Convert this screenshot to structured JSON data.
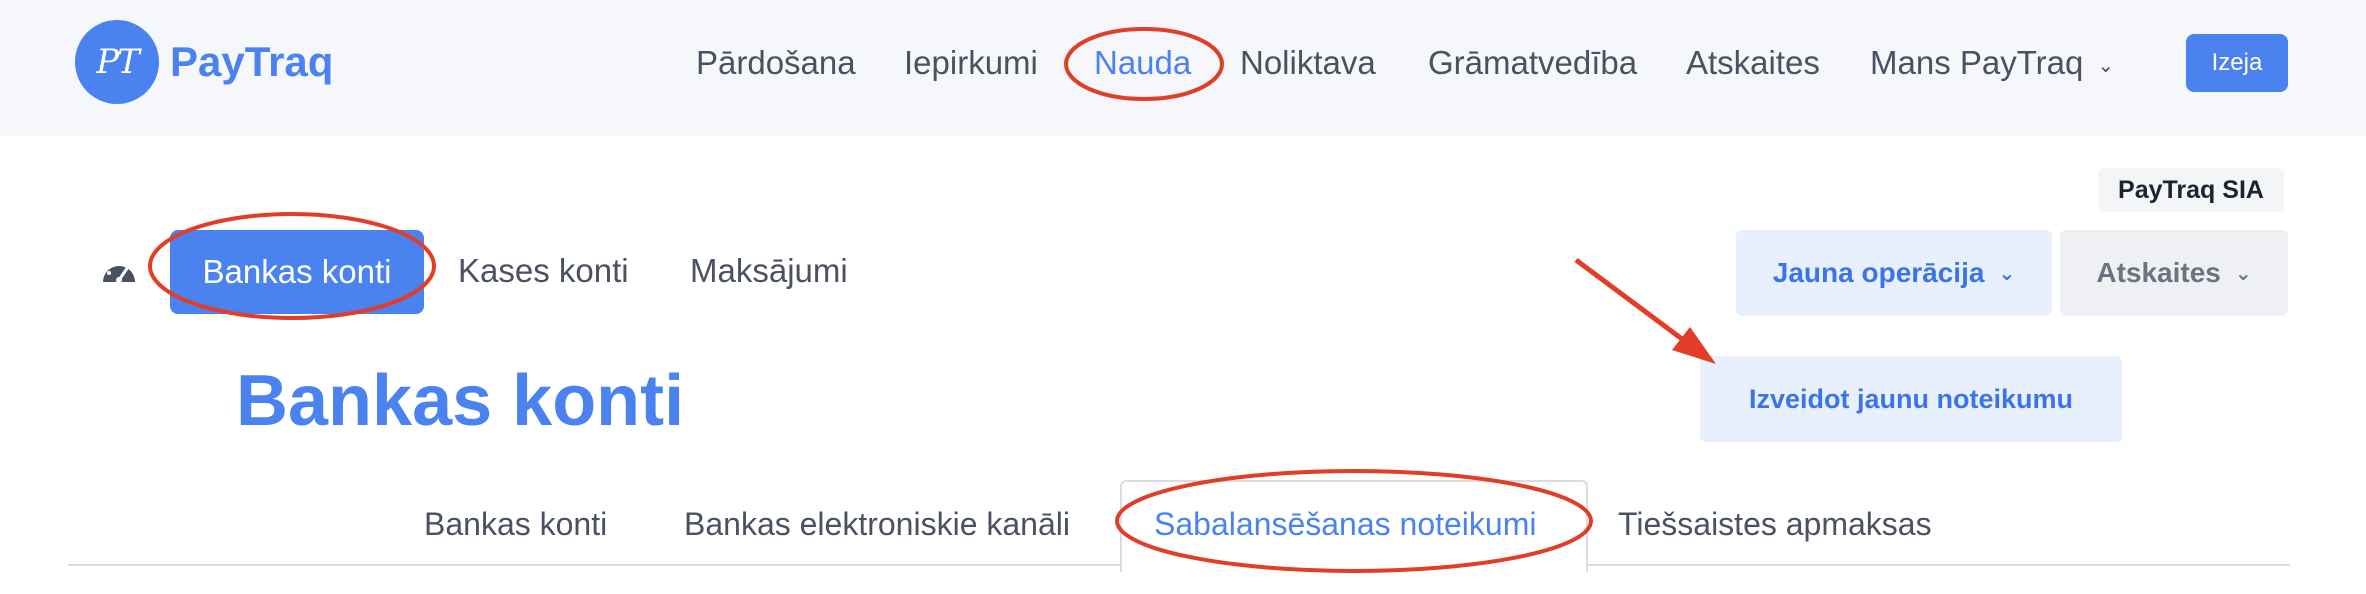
{
  "brand": {
    "logo_initials": "PT",
    "name": "PayTraq",
    "accent_color": "#4a82f0"
  },
  "top_nav": {
    "items": [
      {
        "label": "Pārdošana"
      },
      {
        "label": "Iepirkumi"
      },
      {
        "label": "Nauda"
      },
      {
        "label": "Noliktava"
      },
      {
        "label": "Grāmatvedība"
      },
      {
        "label": "Atskaites"
      },
      {
        "label": "Mans PayTraq"
      }
    ],
    "active_item": "Nauda",
    "exit_label": "Izeja"
  },
  "company": {
    "name": "PayTraq SIA"
  },
  "sub_nav": {
    "items": [
      {
        "label": "Bankas konti"
      },
      {
        "label": "Kases konti"
      },
      {
        "label": "Maksājumi"
      }
    ],
    "active_item": "Bankas konti"
  },
  "actions": {
    "new_operation_label": "Jauna operācija",
    "reports_label": "Atskaites",
    "new_rule_label": "Izveidot jaunu noteikumu"
  },
  "page": {
    "title": "Bankas konti"
  },
  "tabs": {
    "items": [
      {
        "label": "Bankas konti"
      },
      {
        "label": "Bankas elektroniskie kanāli"
      },
      {
        "label": "Sabalansēšanas noteikumi"
      },
      {
        "label": "Tiešsaistes apmaksas"
      }
    ],
    "active_item": "Sabalansēšanas noteikumi"
  },
  "annotation_color": "#e23d28"
}
